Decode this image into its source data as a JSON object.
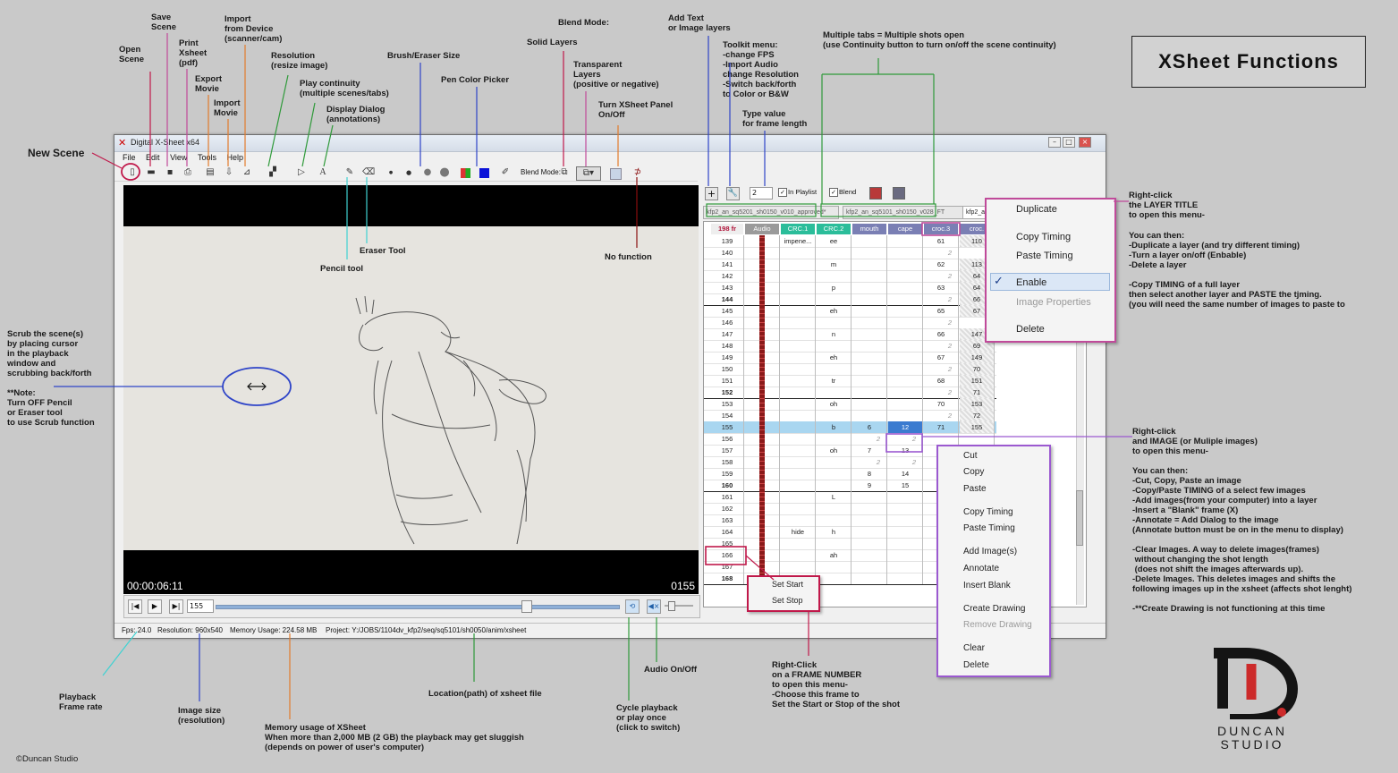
{
  "title_box": "XSheet Functions",
  "app": {
    "window_title": "Digital X-Sheet x64",
    "menu": [
      "File",
      "Edit",
      "View",
      "Tools",
      "Help"
    ],
    "blend_mode_label": "Blend Mode:",
    "timecode": "00:00:06:11",
    "frame_display": "0155",
    "frame_input": "155",
    "frame_length_input": "2",
    "in_playlist_label": "In Playlist",
    "blend_label": "Blend",
    "status": {
      "fps": "Fps: 24.0",
      "resolution": "Resolution: 960x540",
      "memory": "Memory Usage: 224.58 MB",
      "project": "Project: Y:/JOBS/1104dv_kfp2/seq/sq5101/sh0050/anim/xsheet"
    },
    "tabs": [
      "kfp2_an_sq5201_sh0150_v010_approved*",
      "kfp2_an_sq5101_sh0150_v028_FT",
      "kfp2_a"
    ],
    "xsheet": {
      "frame_header": "198 fr",
      "headers": [
        "Audio",
        "CRC.1",
        "CRC.2",
        "mouth",
        "cape",
        "croc.3",
        "croc."
      ],
      "frames": [
        "139",
        "140",
        "141",
        "142",
        "143",
        "144",
        "145",
        "146",
        "147",
        "148",
        "149",
        "150",
        "151",
        "152",
        "153",
        "154",
        "155",
        "156",
        "157",
        "158",
        "159",
        "160",
        "161",
        "162",
        "163",
        "164",
        "165",
        "166",
        "167",
        "168"
      ],
      "crc1": [
        {
          "row": 0,
          "v": "impene..."
        },
        {
          "row": 25,
          "v": "hide"
        }
      ],
      "crc2": [
        {
          "row": 0,
          "v": "ee"
        },
        {
          "row": 2,
          "v": "m"
        },
        {
          "row": 4,
          "v": "p"
        },
        {
          "row": 6,
          "v": "eh"
        },
        {
          "row": 8,
          "v": "n"
        },
        {
          "row": 10,
          "v": "eh"
        },
        {
          "row": 12,
          "v": "tr"
        },
        {
          "row": 14,
          "v": "oh"
        },
        {
          "row": 16,
          "v": "b"
        },
        {
          "row": 18,
          "v": "oh"
        },
        {
          "row": 22,
          "v": "L"
        },
        {
          "row": 25,
          "v": "h"
        },
        {
          "row": 27,
          "v": "ah"
        }
      ],
      "mouth": [
        {
          "row": 16,
          "v": "6"
        },
        {
          "row": 18,
          "v": "7"
        },
        {
          "row": 20,
          "v": "8"
        },
        {
          "row": 21,
          "v": "9"
        }
      ],
      "cape": [
        {
          "row": 16,
          "v": "12"
        },
        {
          "row": 18,
          "v": "13"
        },
        {
          "row": 20,
          "v": "14"
        },
        {
          "row": 21,
          "v": "15"
        }
      ],
      "croc3": [
        {
          "row": 0,
          "v": "61"
        },
        {
          "row": 2,
          "v": "62"
        },
        {
          "row": 4,
          "v": "63"
        },
        {
          "row": 6,
          "v": "65"
        },
        {
          "row": 8,
          "v": "66"
        },
        {
          "row": 10,
          "v": "67"
        },
        {
          "row": 12,
          "v": "68"
        },
        {
          "row": 14,
          "v": "70"
        },
        {
          "row": 16,
          "v": "71"
        }
      ],
      "croc4": [
        {
          "row": 0,
          "v": "110"
        },
        {
          "row": 2,
          "v": "113"
        },
        {
          "row": 3,
          "v": "64"
        },
        {
          "row": 4,
          "v": "64"
        },
        {
          "row": 5,
          "v": "66"
        },
        {
          "row": 6,
          "v": "67"
        },
        {
          "row": 8,
          "v": "147"
        },
        {
          "row": 9,
          "v": "69"
        },
        {
          "row": 10,
          "v": "149"
        },
        {
          "row": 11,
          "v": "70"
        },
        {
          "row": 12,
          "v": "151"
        },
        {
          "row": 13,
          "v": "71"
        },
        {
          "row": 14,
          "v": "153"
        },
        {
          "row": 15,
          "v": "72"
        },
        {
          "row": 16,
          "v": "155"
        }
      ],
      "blank_marker": "2"
    },
    "menu_layer": [
      "Duplicate",
      "Copy Timing",
      "Paste Timing",
      "Enable",
      "Image Properties",
      "Delete"
    ],
    "menu_image": [
      "Cut",
      "Copy",
      "Paste",
      "Copy Timing",
      "Paste Timing",
      "Add Image(s)",
      "Annotate",
      "Insert Blank",
      "Create Drawing",
      "Remove Drawing",
      "Clear",
      "Delete"
    ],
    "menu_frame": [
      "Set Start",
      "Set Stop"
    ]
  },
  "annotations": {
    "new_scene": "New Scene",
    "open_scene": "Open\nScene",
    "save_scene": "Save\nScene",
    "print_xsheet": "Print\nXsheet\n(pdf)",
    "export_movie": "Export\nMovie",
    "import_movie": "Import\nMovie",
    "import_device": "Import\nfrom Device\n(scanner/cam)",
    "resolution": "Resolution\n(resize image)",
    "play_continuity": "Play continuity\n(multiple scenes/tabs)",
    "display_dialog": "Display Dialog\n(annotations)",
    "brush_eraser": "Brush/Eraser Size",
    "pen_color": "Pen Color Picker",
    "solid_layers": "Solid Layers",
    "blend_mode": "Blend Mode:",
    "transparent_layers": "Transparent\nLayers\n(positive or negative)",
    "turn_xsheet_panel": "Turn XSheet Panel\nOn/Off",
    "add_text": "Add Text\nor Image layers",
    "toolkit_menu": "Toolkit menu:\n-change FPS\n-Import Audio\nchange Resolution\n-Switch back/forth\nto Color or B&W",
    "type_value": "Type value\nfor frame length",
    "multiple_tabs": "Multiple tabs = Multiple shots open\n(use Continuity button to turn on/off the scene continuity)",
    "eraser_tool": "Eraser Tool",
    "pencil_tool": "Pencil tool",
    "no_function": "No function",
    "scrub": "Scrub the scene(s)\nby placing cursor\nin the playback\nwindow and\nscrubbing back/forth\n\n**Note:\nTurn OFF Pencil\nor Eraser tool\nto use Scrub function",
    "layer_title_head": "Right-click\nthe LAYER TITLE\nto open this menu-",
    "layer_title_body": "You can then:\n-Duplicate a layer (and try different timing)\n-Turn a layer on/off (Enbable)\n-Delete a layer\n\n-Copy TIMING of a full layer\nthen select another layer and PASTE the tjming.\n(you will need the same number of images to paste to",
    "image_head": "Right-click\nand IMAGE (or Muliple images)\nto open this menu-",
    "image_body": "You can then:\n-Cut, Copy, Paste an image\n-Copy/Paste TIMING of a select few images\n-Add images(from your computer) into a layer\n-Insert a \"Blank\" frame (X)\n-Annotate = Add Dialog to the image\n(Annotate button must be on in the menu to display)\n\n-Clear Images. A way to delete images(frames)\n without changing the shot length\n (does not shift the images afterwards up).\n-Delete Images. This deletes images and shifts the\nfollowing images up in the xsheet (affects shot lenght)\n\n-**Create Drawing is not functioning at this time",
    "frame_number": "Right-Click\non a FRAME NUMBER\nto open this menu-\n-Choose this frame to\nSet the Start or Stop of the shot",
    "audio_onoff": "Audio On/Off",
    "cycle_playback": "Cycle playback\nor play once\n(click to switch)",
    "location": "Location(path) of xsheet file",
    "memory_usage": "Memory usage of XSheet\nWhen more than 2,000 MB (2 GB) the playback may get sluggish\n(depends on power of user's computer)",
    "image_size": "Image size\n(resolution)",
    "playback_rate": "Playback\nFrame rate",
    "copyright": "©Duncan Studio",
    "logo_text": "DUNCAN\nSTUDIO"
  },
  "colors": {
    "accent_red": "#c0184a",
    "magenta": "#c04a9a",
    "purple": "#9b59d0",
    "green": "#2f9a3a",
    "blue": "#2e44c8",
    "orange": "#e37b2c",
    "cyan": "#3fd2d2",
    "xsheet_green": "#2bbd9a",
    "xsheet_purple": "#7a7fb4"
  }
}
